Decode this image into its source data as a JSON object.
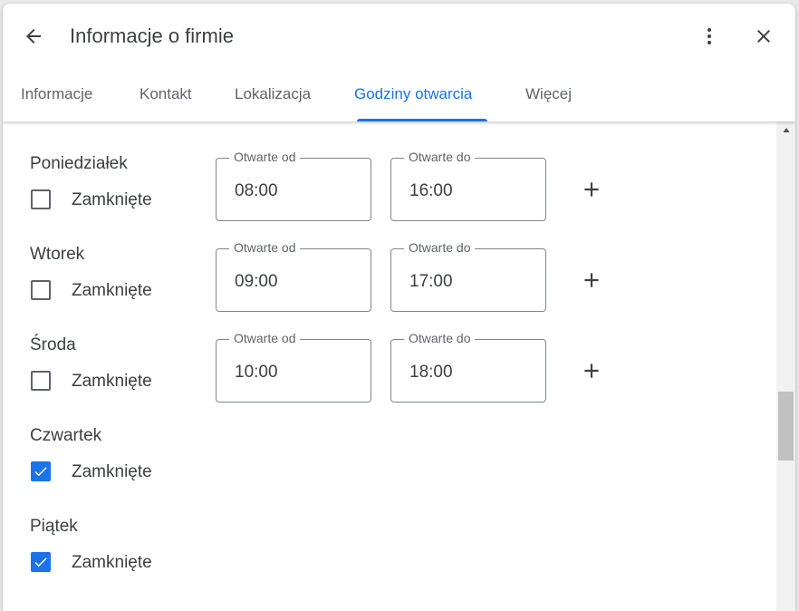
{
  "header": {
    "title": "Informacje o firmie",
    "back_icon": "arrow-back-icon",
    "more_icon": "more-vert-icon",
    "close_icon": "close-icon"
  },
  "tabs": [
    {
      "label": "Informacje",
      "active": false
    },
    {
      "label": "Kontakt",
      "active": false
    },
    {
      "label": "Lokalizacja",
      "active": false
    },
    {
      "label": "Godziny otwarcia",
      "active": true
    },
    {
      "label": "Więcej",
      "active": false
    }
  ],
  "days": [
    {
      "name": "Poniedziałek",
      "closed_label": "Zamknięte",
      "closed": false,
      "from_label": "Otwarte od",
      "from_value": "08:00",
      "to_label": "Otwarte do",
      "to_value": "16:00"
    },
    {
      "name": "Wtorek",
      "closed_label": "Zamknięte",
      "closed": false,
      "from_label": "Otwarte od",
      "from_value": "09:00",
      "to_label": "Otwarte do",
      "to_value": "17:00"
    },
    {
      "name": "Środa",
      "closed_label": "Zamknięte",
      "closed": false,
      "from_label": "Otwarte od",
      "from_value": "10:00",
      "to_label": "Otwarte do",
      "to_value": "18:00"
    },
    {
      "name": "Czwartek",
      "closed_label": "Zamknięte",
      "closed": true
    },
    {
      "name": "Piątek",
      "closed_label": "Zamknięte",
      "closed": true
    }
  ],
  "colors": {
    "accent": "#1a73e8",
    "text": "#3c4043",
    "muted": "#5f6368",
    "border": "#80868b"
  }
}
